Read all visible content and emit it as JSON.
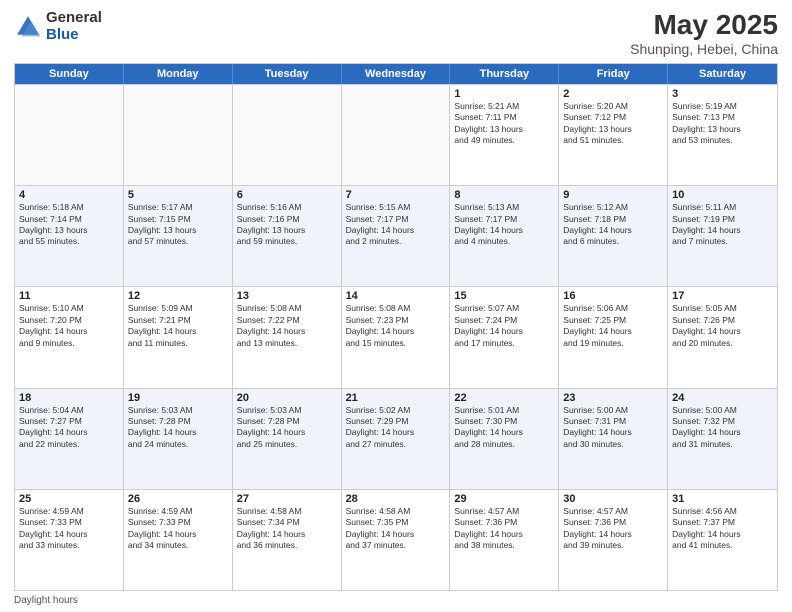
{
  "header": {
    "logo_general": "General",
    "logo_blue": "Blue",
    "title": "May 2025",
    "subtitle": "Shunping, Hebei, China"
  },
  "days_of_week": [
    "Sunday",
    "Monday",
    "Tuesday",
    "Wednesday",
    "Thursday",
    "Friday",
    "Saturday"
  ],
  "footer": {
    "daylight_label": "Daylight hours"
  },
  "weeks": [
    [
      {
        "day": "",
        "text": "",
        "empty": true
      },
      {
        "day": "",
        "text": "",
        "empty": true
      },
      {
        "day": "",
        "text": "",
        "empty": true
      },
      {
        "day": "",
        "text": "",
        "empty": true
      },
      {
        "day": "1",
        "text": "Sunrise: 5:21 AM\nSunset: 7:11 PM\nDaylight: 13 hours\nand 49 minutes.",
        "empty": false,
        "alt": false
      },
      {
        "day": "2",
        "text": "Sunrise: 5:20 AM\nSunset: 7:12 PM\nDaylight: 13 hours\nand 51 minutes.",
        "empty": false,
        "alt": false
      },
      {
        "day": "3",
        "text": "Sunrise: 5:19 AM\nSunset: 7:13 PM\nDaylight: 13 hours\nand 53 minutes.",
        "empty": false,
        "alt": false
      }
    ],
    [
      {
        "day": "4",
        "text": "Sunrise: 5:18 AM\nSunset: 7:14 PM\nDaylight: 13 hours\nand 55 minutes.",
        "empty": false,
        "alt": true
      },
      {
        "day": "5",
        "text": "Sunrise: 5:17 AM\nSunset: 7:15 PM\nDaylight: 13 hours\nand 57 minutes.",
        "empty": false,
        "alt": true
      },
      {
        "day": "6",
        "text": "Sunrise: 5:16 AM\nSunset: 7:16 PM\nDaylight: 13 hours\nand 59 minutes.",
        "empty": false,
        "alt": true
      },
      {
        "day": "7",
        "text": "Sunrise: 5:15 AM\nSunset: 7:17 PM\nDaylight: 14 hours\nand 2 minutes.",
        "empty": false,
        "alt": true
      },
      {
        "day": "8",
        "text": "Sunrise: 5:13 AM\nSunset: 7:17 PM\nDaylight: 14 hours\nand 4 minutes.",
        "empty": false,
        "alt": true
      },
      {
        "day": "9",
        "text": "Sunrise: 5:12 AM\nSunset: 7:18 PM\nDaylight: 14 hours\nand 6 minutes.",
        "empty": false,
        "alt": true
      },
      {
        "day": "10",
        "text": "Sunrise: 5:11 AM\nSunset: 7:19 PM\nDaylight: 14 hours\nand 7 minutes.",
        "empty": false,
        "alt": true
      }
    ],
    [
      {
        "day": "11",
        "text": "Sunrise: 5:10 AM\nSunset: 7:20 PM\nDaylight: 14 hours\nand 9 minutes.",
        "empty": false,
        "alt": false
      },
      {
        "day": "12",
        "text": "Sunrise: 5:09 AM\nSunset: 7:21 PM\nDaylight: 14 hours\nand 11 minutes.",
        "empty": false,
        "alt": false
      },
      {
        "day": "13",
        "text": "Sunrise: 5:08 AM\nSunset: 7:22 PM\nDaylight: 14 hours\nand 13 minutes.",
        "empty": false,
        "alt": false
      },
      {
        "day": "14",
        "text": "Sunrise: 5:08 AM\nSunset: 7:23 PM\nDaylight: 14 hours\nand 15 minutes.",
        "empty": false,
        "alt": false
      },
      {
        "day": "15",
        "text": "Sunrise: 5:07 AM\nSunset: 7:24 PM\nDaylight: 14 hours\nand 17 minutes.",
        "empty": false,
        "alt": false
      },
      {
        "day": "16",
        "text": "Sunrise: 5:06 AM\nSunset: 7:25 PM\nDaylight: 14 hours\nand 19 minutes.",
        "empty": false,
        "alt": false
      },
      {
        "day": "17",
        "text": "Sunrise: 5:05 AM\nSunset: 7:26 PM\nDaylight: 14 hours\nand 20 minutes.",
        "empty": false,
        "alt": false
      }
    ],
    [
      {
        "day": "18",
        "text": "Sunrise: 5:04 AM\nSunset: 7:27 PM\nDaylight: 14 hours\nand 22 minutes.",
        "empty": false,
        "alt": true
      },
      {
        "day": "19",
        "text": "Sunrise: 5:03 AM\nSunset: 7:28 PM\nDaylight: 14 hours\nand 24 minutes.",
        "empty": false,
        "alt": true
      },
      {
        "day": "20",
        "text": "Sunrise: 5:03 AM\nSunset: 7:28 PM\nDaylight: 14 hours\nand 25 minutes.",
        "empty": false,
        "alt": true
      },
      {
        "day": "21",
        "text": "Sunrise: 5:02 AM\nSunset: 7:29 PM\nDaylight: 14 hours\nand 27 minutes.",
        "empty": false,
        "alt": true
      },
      {
        "day": "22",
        "text": "Sunrise: 5:01 AM\nSunset: 7:30 PM\nDaylight: 14 hours\nand 28 minutes.",
        "empty": false,
        "alt": true
      },
      {
        "day": "23",
        "text": "Sunrise: 5:00 AM\nSunset: 7:31 PM\nDaylight: 14 hours\nand 30 minutes.",
        "empty": false,
        "alt": true
      },
      {
        "day": "24",
        "text": "Sunrise: 5:00 AM\nSunset: 7:32 PM\nDaylight: 14 hours\nand 31 minutes.",
        "empty": false,
        "alt": true
      }
    ],
    [
      {
        "day": "25",
        "text": "Sunrise: 4:59 AM\nSunset: 7:33 PM\nDaylight: 14 hours\nand 33 minutes.",
        "empty": false,
        "alt": false
      },
      {
        "day": "26",
        "text": "Sunrise: 4:59 AM\nSunset: 7:33 PM\nDaylight: 14 hours\nand 34 minutes.",
        "empty": false,
        "alt": false
      },
      {
        "day": "27",
        "text": "Sunrise: 4:58 AM\nSunset: 7:34 PM\nDaylight: 14 hours\nand 36 minutes.",
        "empty": false,
        "alt": false
      },
      {
        "day": "28",
        "text": "Sunrise: 4:58 AM\nSunset: 7:35 PM\nDaylight: 14 hours\nand 37 minutes.",
        "empty": false,
        "alt": false
      },
      {
        "day": "29",
        "text": "Sunrise: 4:57 AM\nSunset: 7:36 PM\nDaylight: 14 hours\nand 38 minutes.",
        "empty": false,
        "alt": false
      },
      {
        "day": "30",
        "text": "Sunrise: 4:57 AM\nSunset: 7:36 PM\nDaylight: 14 hours\nand 39 minutes.",
        "empty": false,
        "alt": false
      },
      {
        "day": "31",
        "text": "Sunrise: 4:56 AM\nSunset: 7:37 PM\nDaylight: 14 hours\nand 41 minutes.",
        "empty": false,
        "alt": false
      }
    ]
  ]
}
